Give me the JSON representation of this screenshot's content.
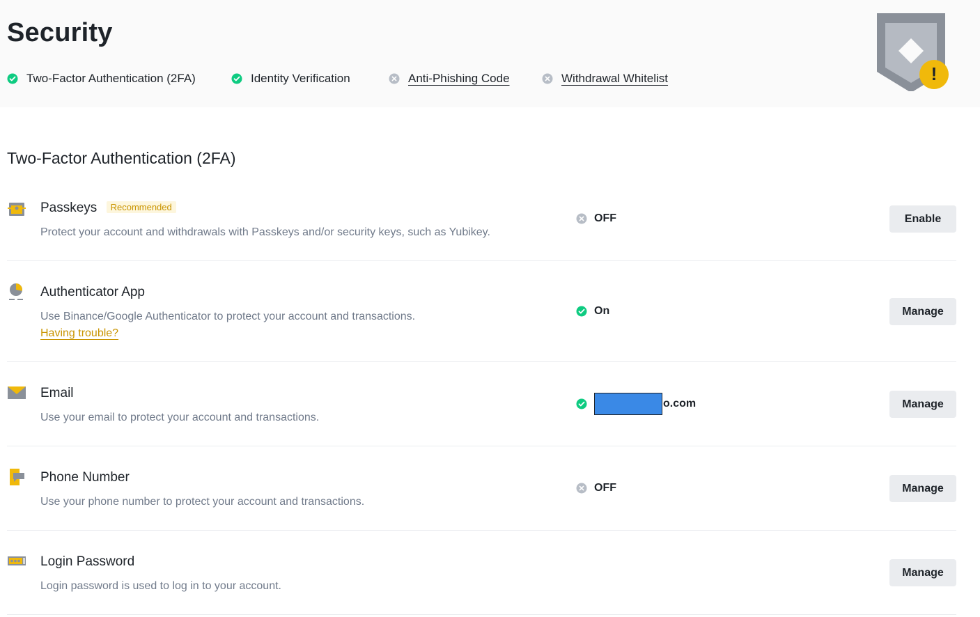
{
  "header": {
    "title": "Security",
    "status_items": [
      {
        "label": "Two-Factor Authentication (2FA)",
        "state": "done",
        "link": false
      },
      {
        "label": "Identity Verification",
        "state": "done",
        "link": false
      },
      {
        "label": "Anti-Phishing Code",
        "state": "not-set",
        "link": true
      },
      {
        "label": "Withdrawal Whitelist",
        "state": "not-set",
        "link": true
      }
    ],
    "warning_glyph": "!"
  },
  "section": {
    "title": "Two-Factor Authentication (2FA)"
  },
  "methods": [
    {
      "icon": "passkey-icon",
      "name": "Passkeys",
      "badge": "Recommended",
      "description": "Protect your account and withdrawals with Passkeys and/or security keys, such as Yubikey.",
      "status": "OFF",
      "status_state": "off",
      "button": "Enable"
    },
    {
      "icon": "authenticator-icon",
      "name": "Authenticator App",
      "description": "Use Binance/Google Authenticator to protect your account and transactions.",
      "help_link": "Having trouble?",
      "status": "On",
      "status_state": "on",
      "button": "Manage"
    },
    {
      "icon": "email-icon",
      "name": "Email",
      "description": "Use your email to protect your account and transactions.",
      "status": "o.com",
      "status_state": "on",
      "redacted": true,
      "button": "Manage"
    },
    {
      "icon": "phone-icon",
      "name": "Phone Number",
      "description": "Use your phone number to protect your account and transactions.",
      "status": "OFF",
      "status_state": "off",
      "button": "Manage"
    },
    {
      "icon": "password-icon",
      "name": "Login Password",
      "description": "Login password is used to log in to your account.",
      "button": "Manage"
    }
  ],
  "colors": {
    "success": "#0ecb81",
    "inactive": "#b7bdc6",
    "accent": "#f0b90b",
    "link": "#c99400",
    "redaction": "#3a89e6"
  }
}
